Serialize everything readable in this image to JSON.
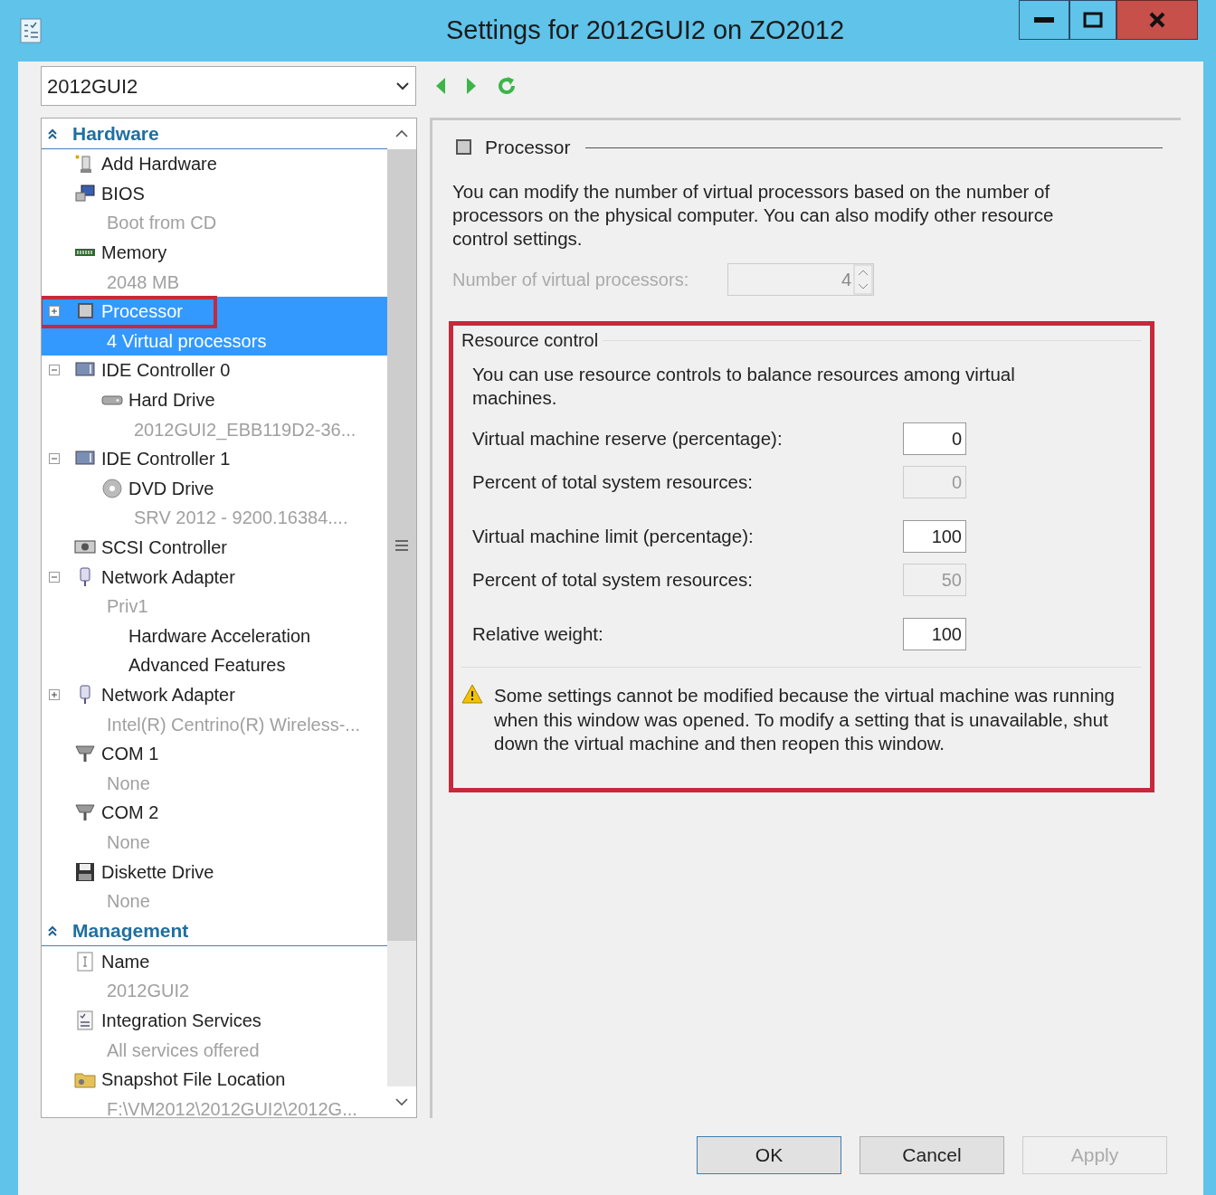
{
  "window": {
    "title": "Settings for 2012GUI2 on ZO2012"
  },
  "vm_selector": {
    "value": "2012GUI2"
  },
  "tree": [
    {
      "title": "Hardware",
      "expanded": true,
      "items": [
        {
          "kind": "add",
          "label": "Add Hardware",
          "selected": false
        },
        {
          "kind": "bios",
          "label": "BIOS",
          "detail": "Boot from CD",
          "selected": false
        },
        {
          "kind": "memory",
          "label": "Memory",
          "detail": "2048 MB",
          "selected": false
        },
        {
          "kind": "chip",
          "label": "Processor",
          "detail": "4 Virtual processors",
          "selected": true,
          "expanded": false,
          "highlighted": true
        },
        {
          "kind": "controller",
          "label": "IDE Controller 0",
          "selected": false,
          "expanded": true,
          "children": [
            {
              "kind": "disk",
              "label": "Hard Drive",
              "detail": "2012GUI2_EBB119D2-36...",
              "selected": false
            }
          ]
        },
        {
          "kind": "controller",
          "label": "IDE Controller 1",
          "selected": false,
          "expanded": true,
          "children": [
            {
              "kind": "disc",
              "label": "DVD Drive",
              "detail": "SRV 2012 - 9200.16384....",
              "selected": false
            }
          ]
        },
        {
          "kind": "scsi",
          "label": "SCSI Controller",
          "selected": false
        },
        {
          "kind": "network",
          "label": "Network Adapter",
          "detail": "Priv1",
          "selected": false,
          "expanded": true,
          "children": [
            {
              "kind": "none",
              "label": "Hardware Acceleration",
              "selected": false
            },
            {
              "kind": "none",
              "label": "Advanced Features",
              "selected": false
            }
          ]
        },
        {
          "kind": "network",
          "label": "Network Adapter",
          "detail": "Intel(R) Centrino(R) Wireless-...",
          "selected": false,
          "expanded": false
        },
        {
          "kind": "port",
          "label": "COM 1",
          "detail": "None",
          "selected": false
        },
        {
          "kind": "port",
          "label": "COM 2",
          "detail": "None",
          "selected": false
        },
        {
          "kind": "floppy",
          "label": "Diskette Drive",
          "detail": "None",
          "selected": false
        }
      ]
    },
    {
      "title": "Management",
      "expanded": true,
      "items": [
        {
          "kind": "name",
          "label": "Name",
          "detail": "2012GUI2",
          "selected": false
        },
        {
          "kind": "checklist",
          "label": "Integration Services",
          "detail": "All services offered",
          "selected": false
        },
        {
          "kind": "folder",
          "label": "Snapshot File Location",
          "detail": "F:\\VM2012\\2012GUI2\\2012G...",
          "selected": false
        }
      ]
    }
  ],
  "panel": {
    "heading": "Processor",
    "description": "You can modify the number of virtual processors based on the number of processors on the physical computer. You can also modify other resource control settings.",
    "processors": {
      "label": "Number of virtual processors:",
      "value": "4",
      "disabled": true
    },
    "resource_control": {
      "title": "Resource control",
      "highlighted": true,
      "description": "You can use resource controls to balance resources among virtual machines.",
      "fields": [
        {
          "label": "Virtual machine reserve (percentage):",
          "value": "0",
          "disabled": false
        },
        {
          "label": "Percent of total system resources:",
          "value": "0",
          "disabled": true
        },
        {
          "label": "Virtual machine limit (percentage):",
          "value": "100",
          "disabled": false
        },
        {
          "label": "Percent of total system resources:",
          "value": "50",
          "disabled": true
        },
        {
          "label": "Relative weight:",
          "value": "100",
          "disabled": false
        }
      ],
      "warning": "Some settings cannot be modified because the virtual machine was running when this window was opened. To modify a setting that is unavailable, shut down the virtual machine and then reopen this window."
    }
  },
  "buttons": [
    {
      "label": "OK",
      "disabled": false
    },
    {
      "label": "Cancel",
      "disabled": false
    },
    {
      "label": "Apply",
      "disabled": true
    }
  ]
}
